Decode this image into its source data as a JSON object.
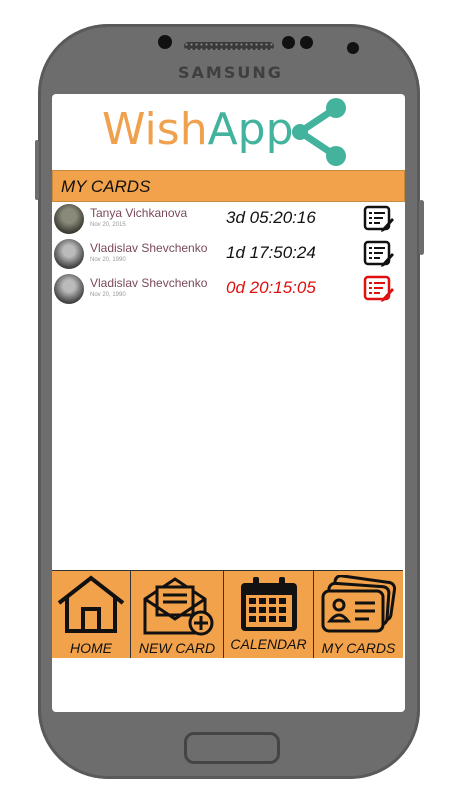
{
  "device": {
    "brand": "SAMSUNG"
  },
  "app": {
    "logo_left": "Wish",
    "logo_right": "App",
    "accent_orange": "#f2a24a",
    "accent_teal": "#44b39d"
  },
  "section": {
    "title": "MY CARDS"
  },
  "cards": [
    {
      "name": "Tanya Vichkanova",
      "date": "Nov 20, 2015",
      "countdown": "3d  05:20:16",
      "urgent": false
    },
    {
      "name": "Vladislav Shevchenko",
      "date": "Nov 20, 1990",
      "countdown": "1d  17:50:24",
      "urgent": false
    },
    {
      "name": "Vladislav Shevchenko",
      "date": "Nov 20, 1990",
      "countdown": "0d 20:15:05",
      "urgent": true
    }
  ],
  "nav": {
    "home": "HOME",
    "new_card": "NEW CARD",
    "calendar": "CALENDAR",
    "my_cards": "MY CARDS"
  },
  "colors": {
    "urgent": "#e01010"
  }
}
